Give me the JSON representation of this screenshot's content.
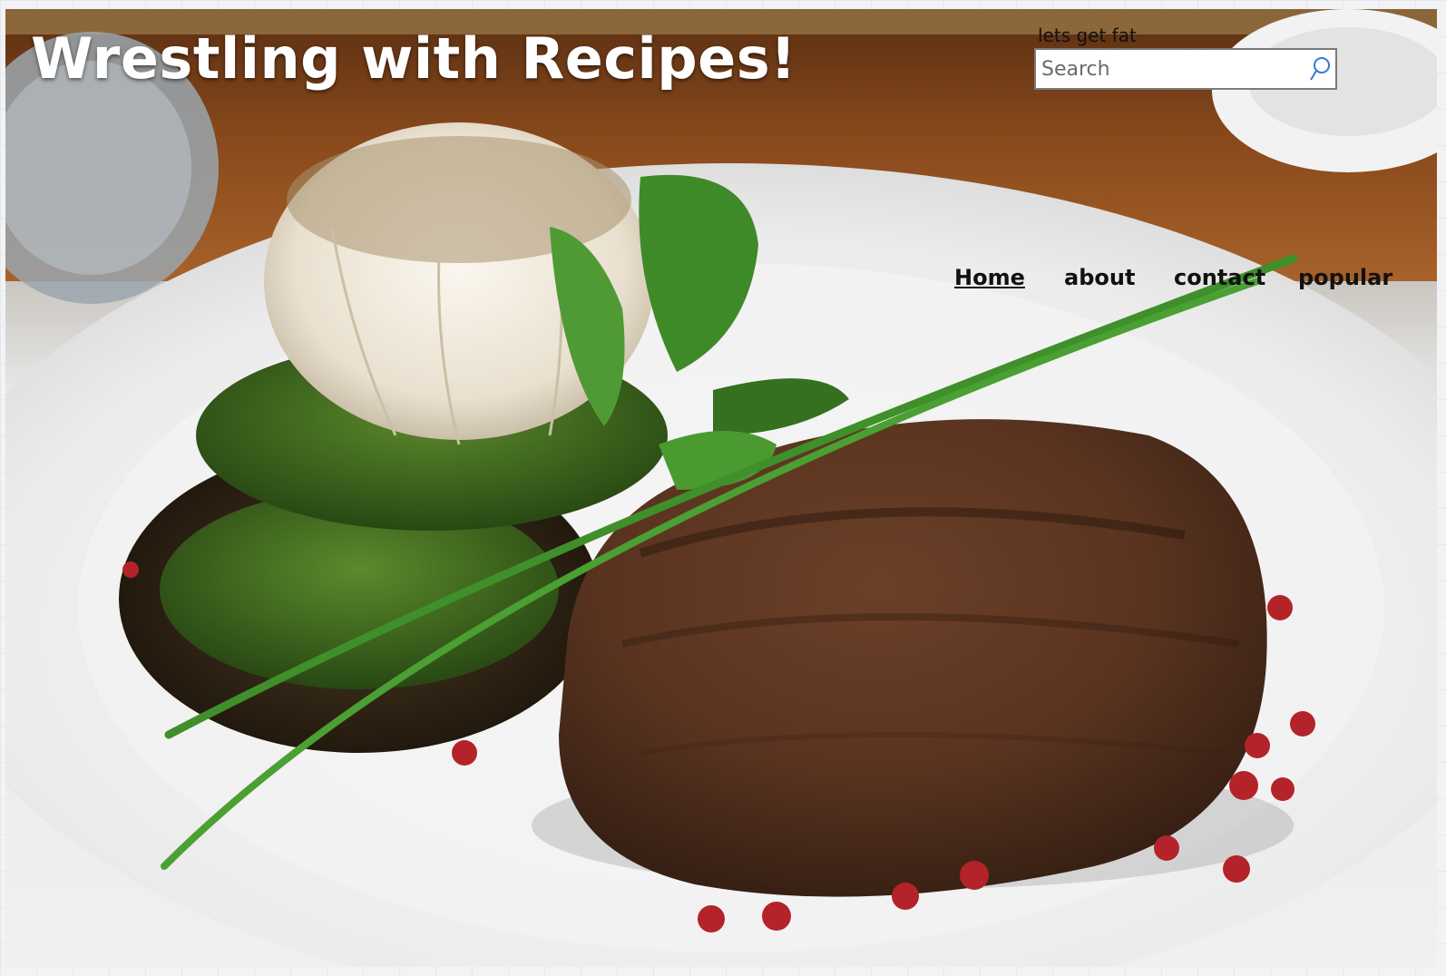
{
  "header": {
    "site_title": "Wrestling with Recipes!",
    "tagline": "lets get fat"
  },
  "search": {
    "placeholder": "Search",
    "value": "",
    "icon": "search-icon"
  },
  "nav": {
    "items": [
      {
        "label": "Home",
        "active": true
      },
      {
        "label": "about",
        "active": false
      },
      {
        "label": "contact",
        "active": false
      },
      {
        "label": "popular",
        "active": false
      }
    ]
  },
  "hero": {
    "image": "grilled-steak-plate-photo"
  },
  "colors": {
    "title": "#ffffff",
    "nav_text": "#111111",
    "search_border": "#7a7a7a",
    "search_icon": "#2f7bd6"
  }
}
